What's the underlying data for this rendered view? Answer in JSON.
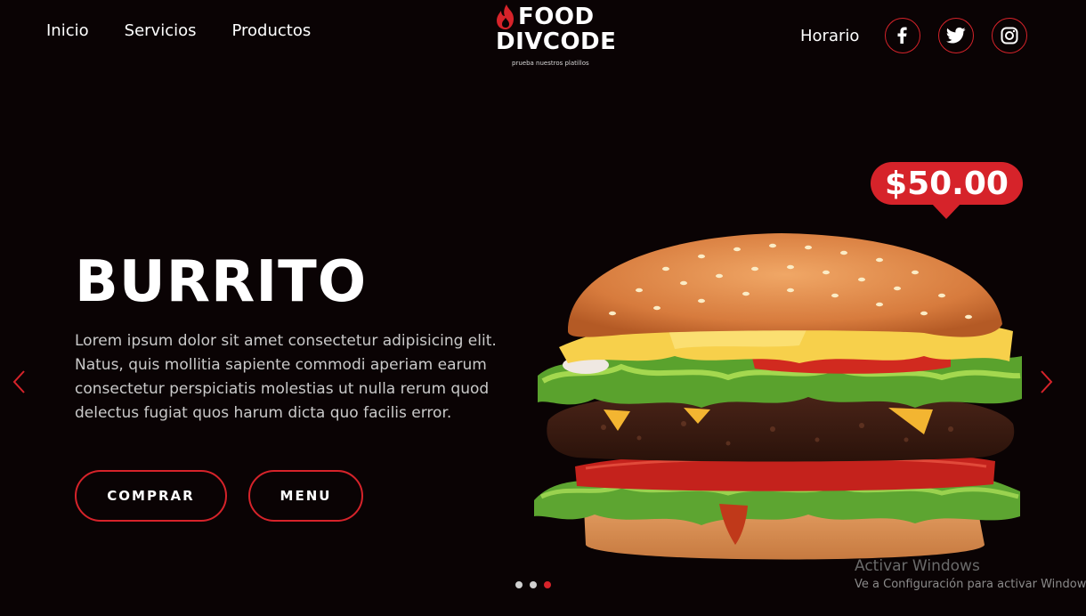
{
  "nav": {
    "links": [
      "Inicio",
      "Servicios",
      "Productos"
    ],
    "horario": "Horario"
  },
  "logo": {
    "line1": "FOOD",
    "line2": "DIVCODE",
    "tagline": "prueba nuestros platillos"
  },
  "social": [
    "facebook-icon",
    "twitter-icon",
    "instagram-icon"
  ],
  "hero": {
    "title": "BURRITO",
    "description": "Lorem ipsum dolor sit amet consectetur adipisicing elit. Natus, quis mollitia sapiente commodi aperiam earum consectetur perspiciatis molestias ut nulla rerum quod delectus fugiat quos harum dicta quo facilis error.",
    "buttons": {
      "comprar": "COMPRAR",
      "menu": "MENU"
    },
    "price": "$50.00"
  },
  "carousel": {
    "slides": 3,
    "active_index": 2
  },
  "watermark": {
    "title": "Activar Windows",
    "subtitle": "Ve a Configuración para activar Windows."
  },
  "colors": {
    "accent": "#d6232a",
    "background": "#0a0304",
    "text": "#ffffff"
  }
}
